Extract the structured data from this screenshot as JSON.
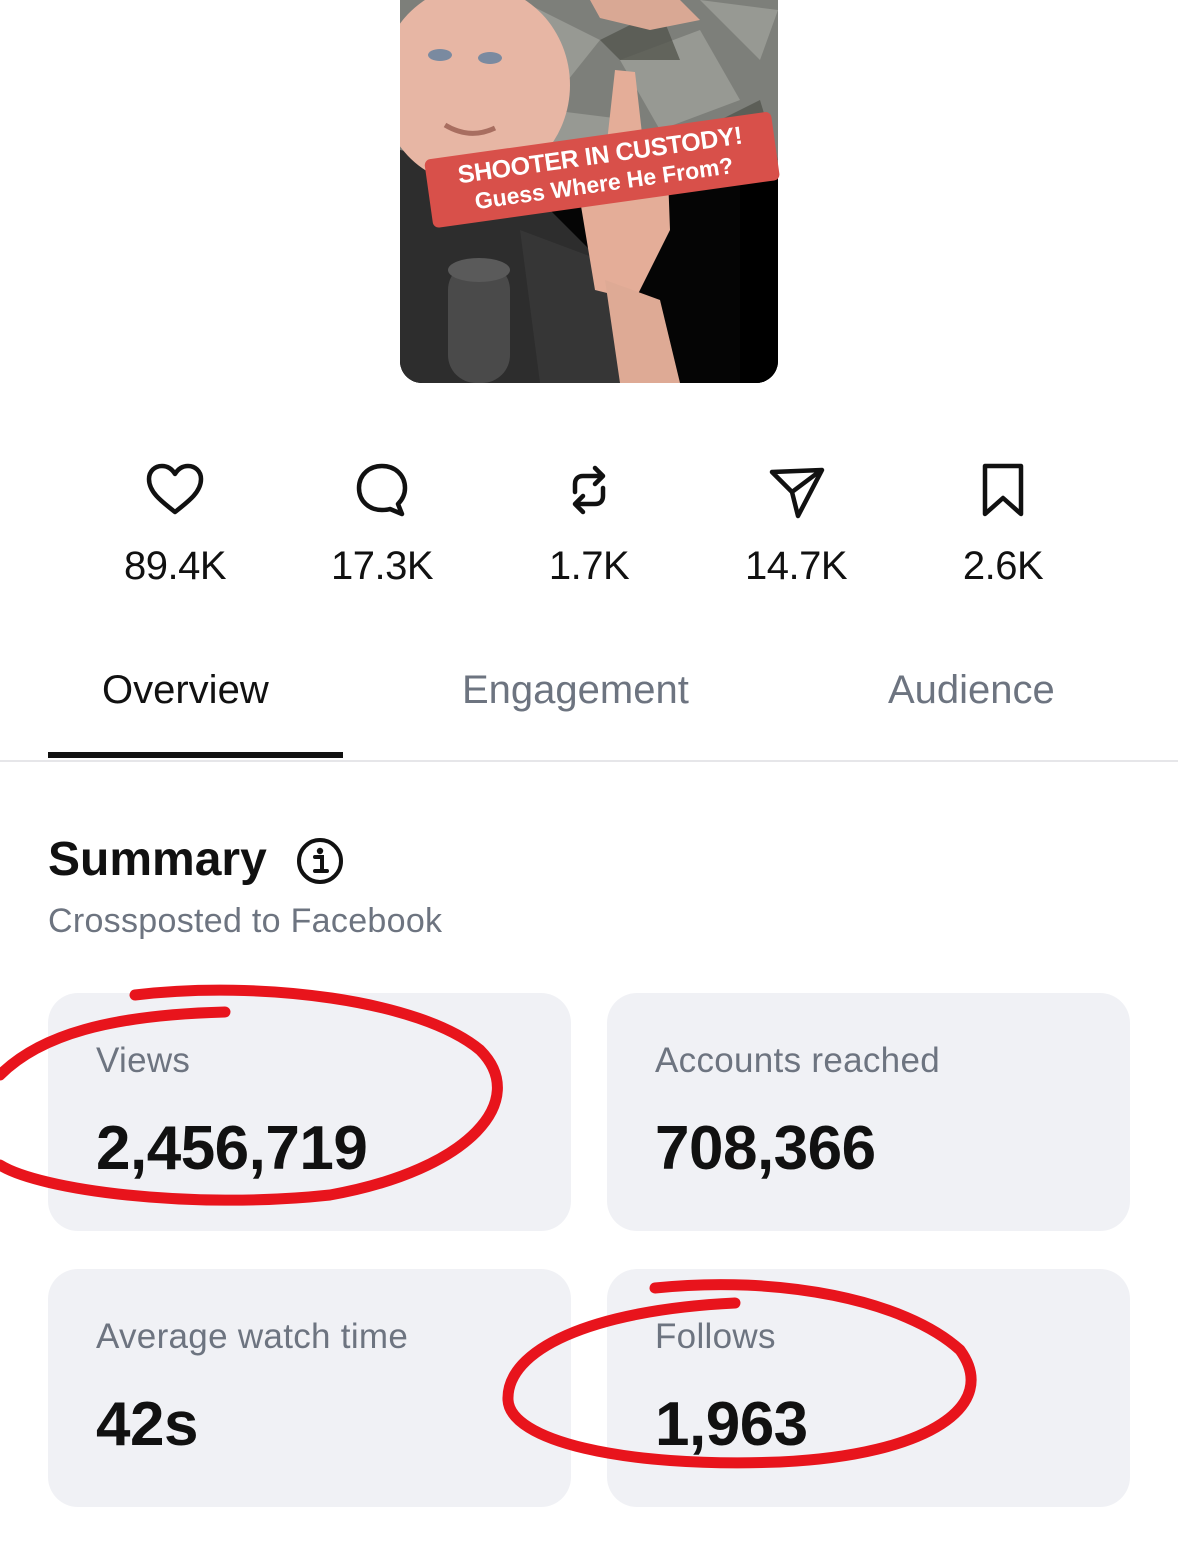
{
  "thumbnail": {
    "caption_line1": "SHOOTER IN CUSTODY!",
    "caption_line2": "Guess Where He From?"
  },
  "stats": [
    {
      "icon": "heart-icon",
      "value": "89.4K"
    },
    {
      "icon": "comment-icon",
      "value": "17.3K"
    },
    {
      "icon": "repost-icon",
      "value": "1.7K"
    },
    {
      "icon": "share-icon",
      "value": "14.7K"
    },
    {
      "icon": "bookmark-icon",
      "value": "2.6K"
    }
  ],
  "tabs": [
    {
      "label": "Overview",
      "active": true
    },
    {
      "label": "Engagement",
      "active": false
    },
    {
      "label": "Audience",
      "active": false
    }
  ],
  "summary": {
    "title": "Summary",
    "subtitle": "Crossposted to Facebook",
    "info_icon": "info-icon"
  },
  "metrics": [
    {
      "label": "Views",
      "value": "2,456,719"
    },
    {
      "label": "Accounts reached",
      "value": "708,366"
    },
    {
      "label": "Average watch time",
      "value": "42s"
    },
    {
      "label": "Follows",
      "value": "1,963"
    }
  ],
  "colors": {
    "annotation": "#e8141c",
    "card_bg": "#f0f1f5",
    "muted_text": "#6d7480",
    "caption_bg": "#d8504a"
  }
}
